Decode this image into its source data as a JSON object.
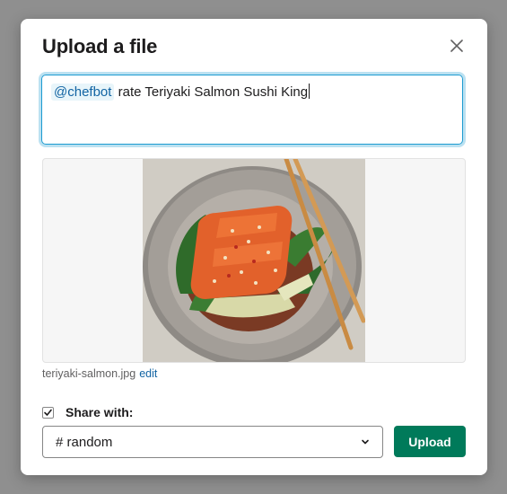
{
  "dialog": {
    "title": "Upload a file",
    "close_icon": "close-icon"
  },
  "message": {
    "mention": "@chefbot",
    "text": " rate Teriyaki Salmon Sushi King"
  },
  "file": {
    "name": "teriyaki-salmon.jpg",
    "edit_label": "edit"
  },
  "share": {
    "checkbox_checked": true,
    "label": "Share with:",
    "channel": "# random",
    "dropdown_icon": "chevron-down-icon"
  },
  "actions": {
    "upload_label": "Upload"
  },
  "colors": {
    "accent": "#007a5a",
    "focus": "#1d9bd1",
    "link": "#1264a3"
  }
}
